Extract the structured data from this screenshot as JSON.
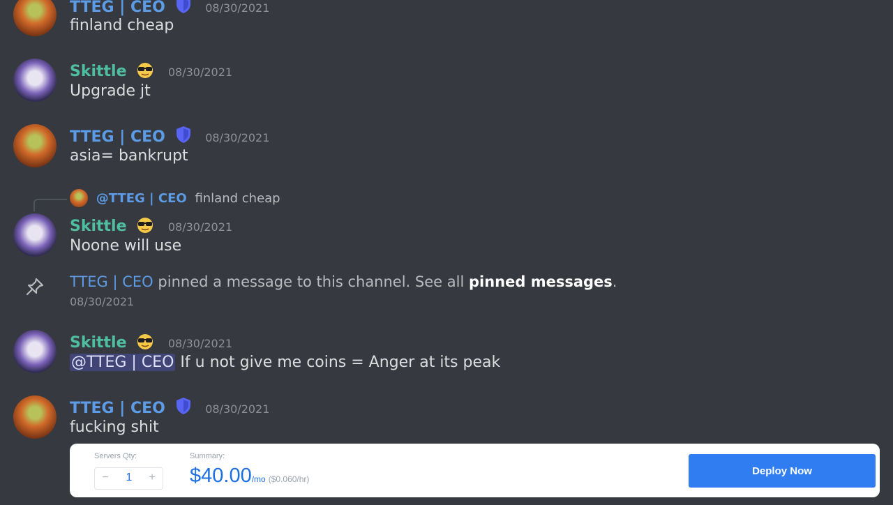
{
  "messages": [
    {
      "author": "TTEG | CEO",
      "timestamp": "08/30/2021",
      "text": "finland cheap"
    },
    {
      "author": "Skittle",
      "timestamp": "08/30/2021",
      "text": "Upgrade jt"
    },
    {
      "author": "TTEG | CEO",
      "timestamp": "08/30/2021",
      "text": "asia= bankrupt"
    },
    {
      "author": "Skittle",
      "timestamp": "08/30/2021",
      "text": "Noone will use",
      "reply": {
        "author": "@TTEG | CEO",
        "text": "finland cheap"
      }
    },
    {
      "author": "Skittle",
      "timestamp": "08/30/2021",
      "mention": "@TTEG | CEO",
      "text": "If u not give me coins = Anger at its peak"
    },
    {
      "author": "TTEG | CEO",
      "timestamp": "08/30/2021",
      "text": "fucking shit"
    }
  ],
  "system": {
    "author": "TTEG | CEO",
    "text_before": "pinned a message to this channel. See all",
    "link": "pinned messages",
    "text_after": ".",
    "timestamp": "08/30/2021",
    "icon": "pin-icon"
  },
  "colors": {
    "tteg_name": "#5c9ce6",
    "skittle_name": "#4fbf9f",
    "background": "#36393f",
    "deploy_button": "#2f7df1"
  },
  "deploy_bar": {
    "servers_label": "Servers Qty:",
    "minus": "−",
    "quantity": "1",
    "plus": "+",
    "summary_label": "Summary:",
    "price": "$40.00",
    "per": "/mo",
    "hourly": "($0.060/hr)",
    "button": "Deploy Now"
  }
}
